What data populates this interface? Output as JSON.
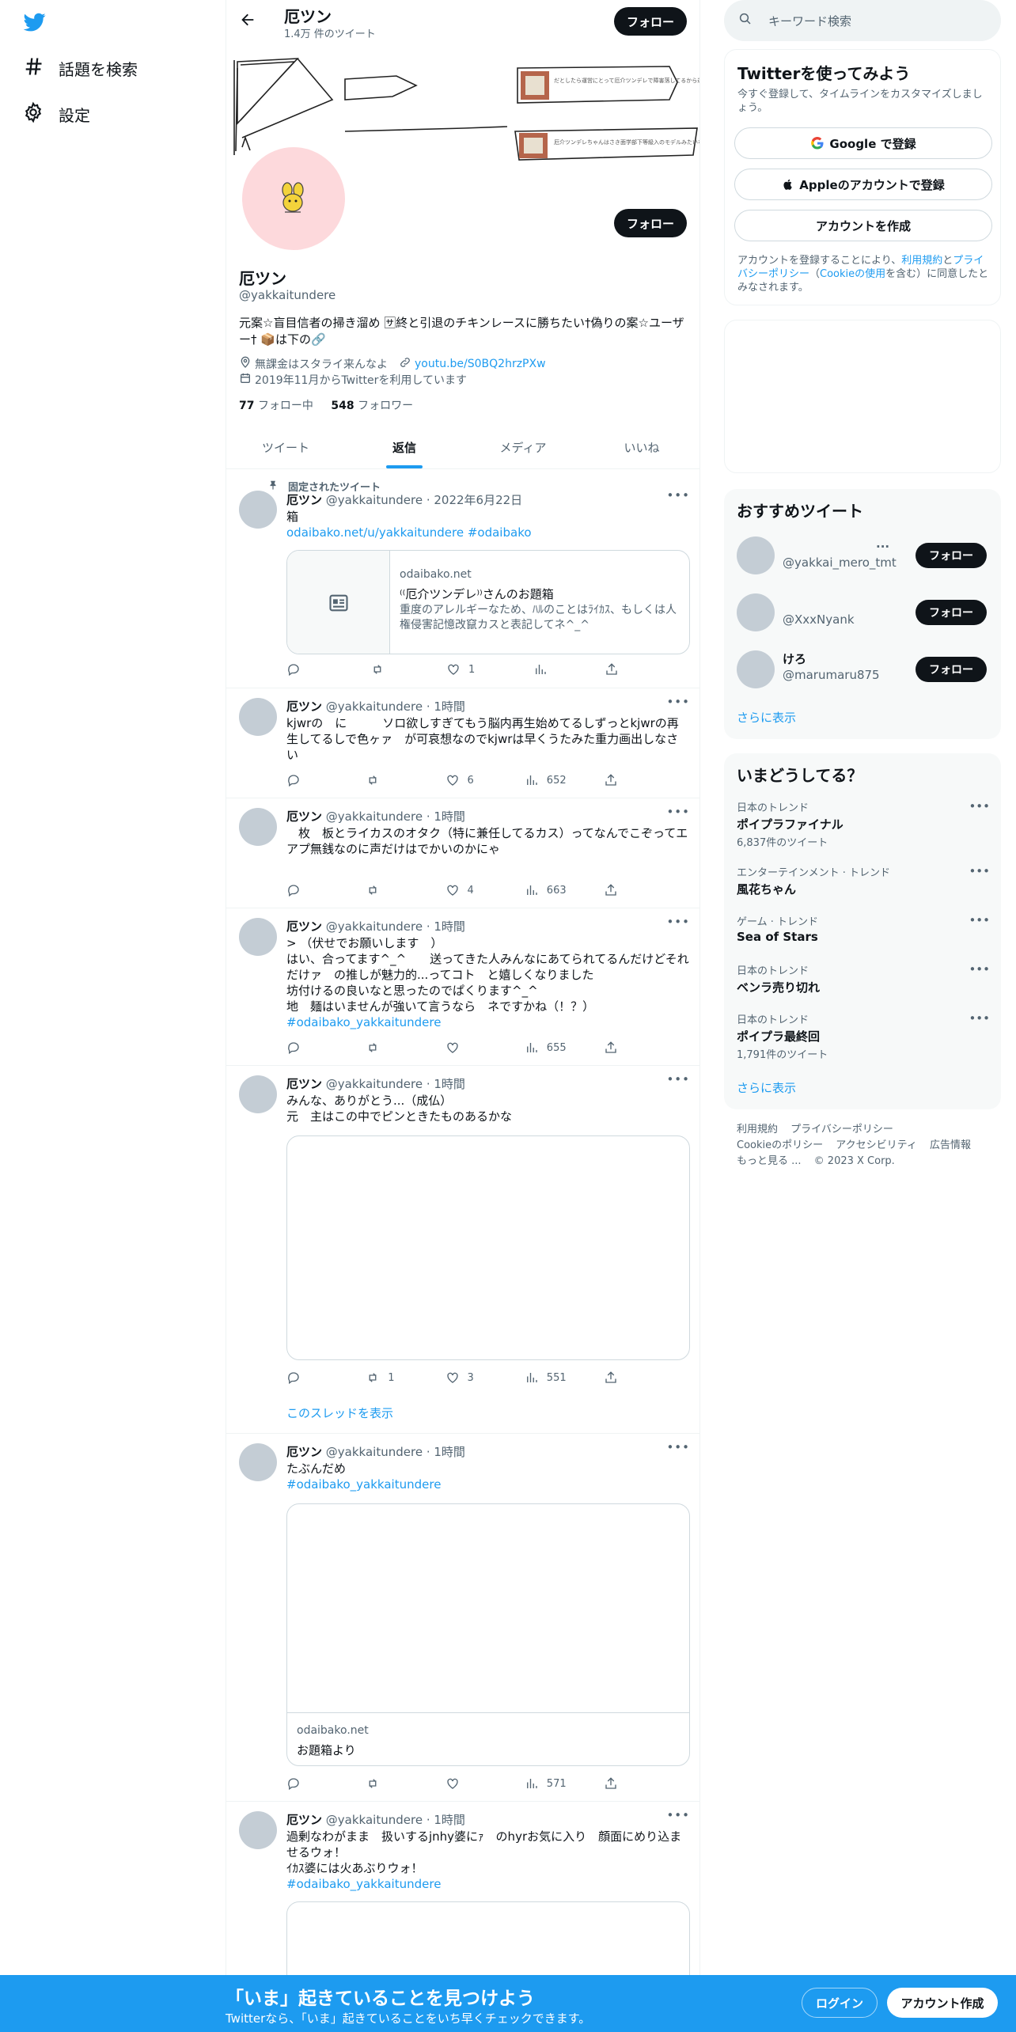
{
  "nav": {
    "items": [
      {
        "label": "話題を検索",
        "icon": "hashtag-icon"
      },
      {
        "label": "設定",
        "icon": "gear-icon"
      }
    ]
  },
  "header": {
    "name": "厄ツン",
    "tweet_count": "1.4万 件のツイート",
    "follow_label": "フォロー"
  },
  "profile": {
    "name": "厄ツン",
    "handle": "@yakkaitundere",
    "follow_label": "フォロー",
    "bio": "元案☆盲目信者の掃き溜め 🈂終と引退のチキンレースに勝ちたい†偽りの案☆ユーザー† 📦は下の🔗",
    "location": "無課金はスタライ来んなよ",
    "link": "youtu.be/S0BQ2hrzPXw",
    "joined": "2019年11月からTwitterを利用しています",
    "following_count": "77",
    "following_label": "フォロー中",
    "followers_count": "548",
    "followers_label": "フォロワー",
    "banner_text_1": "だとしたら運営にとって厄介ツンデレで障害落してるから運営に嫌はないか一覧",
    "banner_text_2": "厄介ツンデレちゃんはさき面学部下等級入のモデルみたいな展示会なんだろうね"
  },
  "tabs": [
    "ツイート",
    "返信",
    "メディア",
    "いいね"
  ],
  "pinned_label": "固定されたツイート",
  "tweets": [
    {
      "name": "厄ツン",
      "handle": "@yakkaitundere",
      "time": "· 2022年6月22日",
      "text": "箱",
      "link": "odaibako.net/u/yakkaitundere #odaibako",
      "card_domain": "odaibako.net",
      "card_title": "⁽⁽厄介ツンデレ⁾⁾さんのお題箱",
      "card_desc": "重度のアレルギーなため、ﾊﾙのことはﾗｲｶｽ、もしくは人権侵害記憶改竄カスと表記してネ^_^",
      "replies": "",
      "retweets": "",
      "likes": "1",
      "views": ""
    },
    {
      "name": "厄ツン",
      "handle": "@yakkaitundere",
      "time": "· 1時間",
      "text": "kjwrの　に　　　ソロ欲しすぎてもう脳内再生始めてるしずっとkjwrの再生してるしで色ヶァ　が可哀想なのでkjwrは早くうたみた重力画出しなさい",
      "replies": "",
      "retweets": "",
      "likes": "6",
      "views": "652"
    },
    {
      "name": "厄ツン",
      "handle": "@yakkaitundere",
      "time": "· 1時間",
      "text": "　枚　板とライカスのオタク（特に兼任してるカス）ってなんでこぞってエアプ無銭なのに声だけはでかいのかにゃ",
      "replies": "",
      "retweets": "",
      "likes": "4",
      "views": "663"
    },
    {
      "name": "厄ツン",
      "handle": "@yakkaitundere",
      "time": "· 1時間",
      "text": "> （伏せでお願いします　）\nはい、合ってます^_^　　送ってきた人みんなにあてられてるんだけどそれだけァ　の推しが魅力的...ってコト　と嬉しくなりました\n坊付けるの良いなと思ったのでぱくります^_^\n地　麺はいませんが強いて言うなら　ネですかね（！？）",
      "hashtag": "#odaibako_yakkaitundere",
      "replies": "",
      "retweets": "",
      "likes": "",
      "views": "655"
    },
    {
      "name": "厄ツン",
      "handle": "@yakkaitundere",
      "time": "· 1時間",
      "text": "みんな、ありがとう...（成仏）\n元　主はこの中でピンときたものあるかな",
      "thread_link": "このスレッドを表示",
      "replies": "",
      "retweets": "1",
      "likes": "3",
      "views": "551"
    },
    {
      "name": "厄ツン",
      "handle": "@yakkaitundere",
      "time": "· 1時間",
      "text": "たぶんだめ",
      "hashtag": "#odaibako_yakkaitundere",
      "card_domain": "odaibako.net",
      "card_title": "お題箱より",
      "replies": "",
      "retweets": "",
      "likes": "",
      "views": "571"
    },
    {
      "name": "厄ツン",
      "handle": "@yakkaitundere",
      "time": "· 1時間",
      "text": "過剰なわがまま　扱いするjnhy婆にｧ　のhyrお気に入り　顔面にめり込ませるウォ！\nｲｶｽ婆には火あぶりウォ！",
      "hashtag": "#odaibako_yakkaitundere"
    }
  ],
  "right": {
    "search_placeholder": "キーワード検索",
    "signup_title": "Twitterを使ってみよう",
    "signup_desc": "今すぐ登録して、タイムラインをカスタマイズしましょう。",
    "google_btn": "Google で登録",
    "apple_btn": "Appleのアカウントで登録",
    "create_btn": "アカウントを作成",
    "terms_pre": "アカウントを登録することにより、",
    "terms_link1": "利用規約",
    "terms_and": "と",
    "terms_link2": "プライバシーポリシー",
    "terms_paren_open": "（",
    "terms_link3": "Cookieの使用",
    "terms_post": "を含む）に同意したとみなされます。",
    "rec_title": "おすすめツイート",
    "rec_users": [
      {
        "name": "...",
        "handle": "@yakkai_mero_tmt",
        "btn": "フォロー"
      },
      {
        "name": "",
        "handle": "@XxxNyank",
        "btn": "フォロー"
      },
      {
        "name": "けろ",
        "handle": "@marumaru875",
        "btn": "フォロー"
      }
    ],
    "show_more": "さらに表示",
    "trends_title": "いまどうしてる？",
    "trends": [
      {
        "cat": "日本のトレンド",
        "name": "ポイプラファイナル",
        "count": "6,837件のツイート"
      },
      {
        "cat": "エンターテインメント · トレンド",
        "name": "風花ちゃん",
        "count": ""
      },
      {
        "cat": "ゲーム · トレンド",
        "name": "Sea of Stars",
        "count": ""
      },
      {
        "cat": "日本のトレンド",
        "name": "ベンラ売り切れ",
        "count": ""
      },
      {
        "cat": "日本のトレンド",
        "name": "ポイプラ最終回",
        "count": "1,791件のツイート"
      }
    ],
    "trends_more": "さらに表示",
    "footer": [
      "利用規約",
      "プライバシーポリシー",
      "Cookieのポリシー",
      "アクセシビリティ",
      "広告情報",
      "もっと見る ...",
      "© 2023 X Corp."
    ]
  },
  "bottombar": {
    "title": "「いま」起きていることを見つけよう",
    "subtitle": "Twitterなら、「いま」起きていることをいち早くチェックできます。",
    "login": "ログイン",
    "signup": "アカウント作成"
  },
  "colors": {
    "accent": "#1d9bf0",
    "text": "#0f1419",
    "muted": "#536471",
    "avatar_bg": "#fdd9dc"
  }
}
